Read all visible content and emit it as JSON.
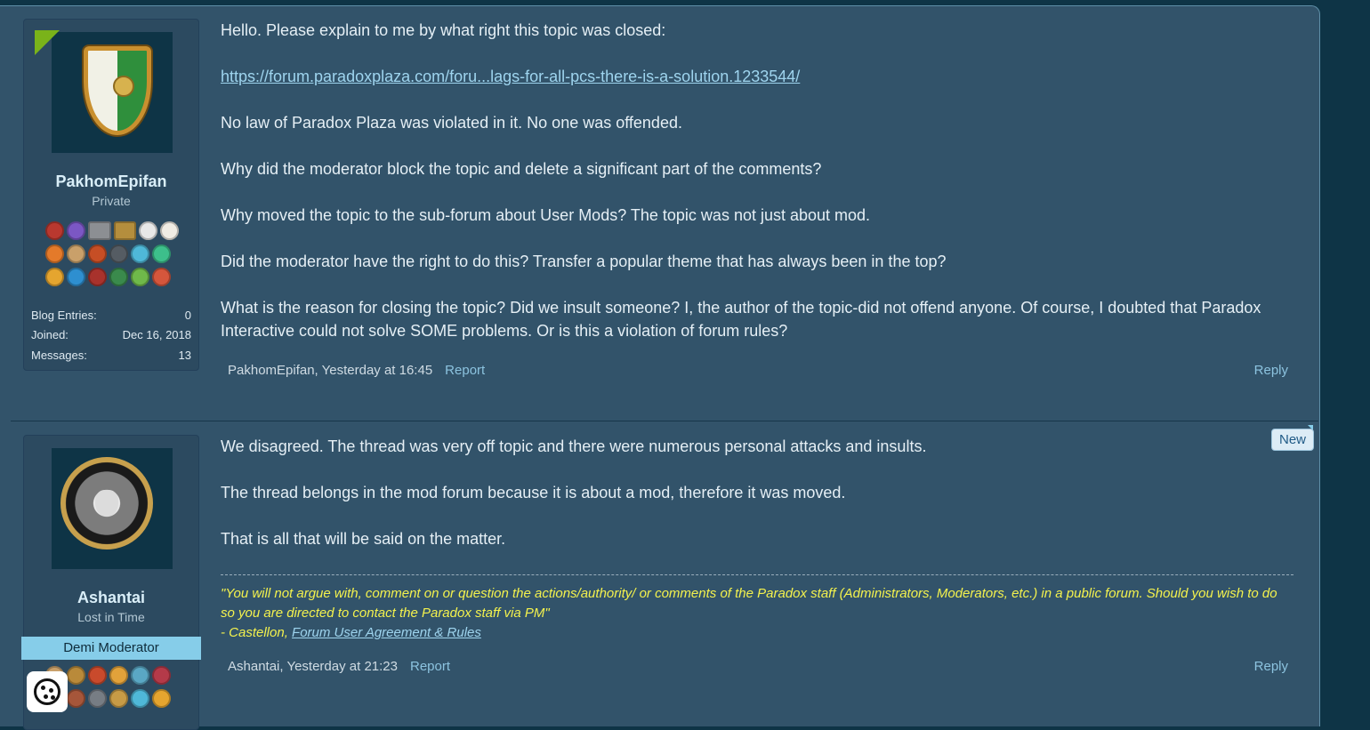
{
  "posts": [
    {
      "author": "PakhomEpifan",
      "title": "Private",
      "stats": [
        {
          "label": "Blog Entries:",
          "value": "0"
        },
        {
          "label": "Joined:",
          "value": "Dec 16, 2018"
        },
        {
          "label": "Messages:",
          "value": "13"
        }
      ],
      "paragraphs": [
        "Hello. Please explain to me by what right this topic was closed:",
        "No law of Paradox Plaza was violated in it. No one was offended.",
        "Why did the moderator block the topic and delete a significant part of the comments?",
        "Why moved the topic to the sub-forum about User Mods? The topic was not just about mod.",
        "Did the moderator have the right to do this? Transfer a popular theme that has always been in the top?",
        "What is the reason for closing the topic? Did we insult someone? I, the author of the topic-did not offend anyone. Of course, I doubted that Paradox Interactive could not solve SOME problems. Or is this a violation of forum rules?"
      ],
      "link": "https://forum.paradoxplaza.com/foru...lags-for-all-pcs-there-is-a-solution.1233544/",
      "byline": "PakhomEpifan, Yesterday at 16:45",
      "report": "Report",
      "reply": "Reply"
    },
    {
      "author": "Ashantai",
      "title": "Lost in Time",
      "role": "Demi Moderator",
      "badge": "New",
      "paragraphs": [
        "We disagreed. The thread was very off topic and there were numerous personal attacks and insults.",
        "The thread belongs in the mod forum because it is about a mod, therefore it was moved.",
        "That is all that will be said on the matter."
      ],
      "signature": {
        "quote": "\"You will not argue with, comment on or question the actions/authority/ or comments of the Paradox staff (Administrators, Moderators, etc.) in a public forum. Should you wish to do so you are directed to contact the Paradox staff via PM\"",
        "attribution": "- Castellon, ",
        "link": "Forum User Agreement & Rules"
      },
      "byline": "Ashantai, Yesterday at 21:23",
      "report": "Report",
      "reply": "Reply"
    }
  ],
  "colors": {
    "page_bg": "#0e3446",
    "post_bg": "#32536a",
    "link": "#9ed4ee",
    "signature": "#f4f24d",
    "staff_banner": "#86cde9"
  }
}
